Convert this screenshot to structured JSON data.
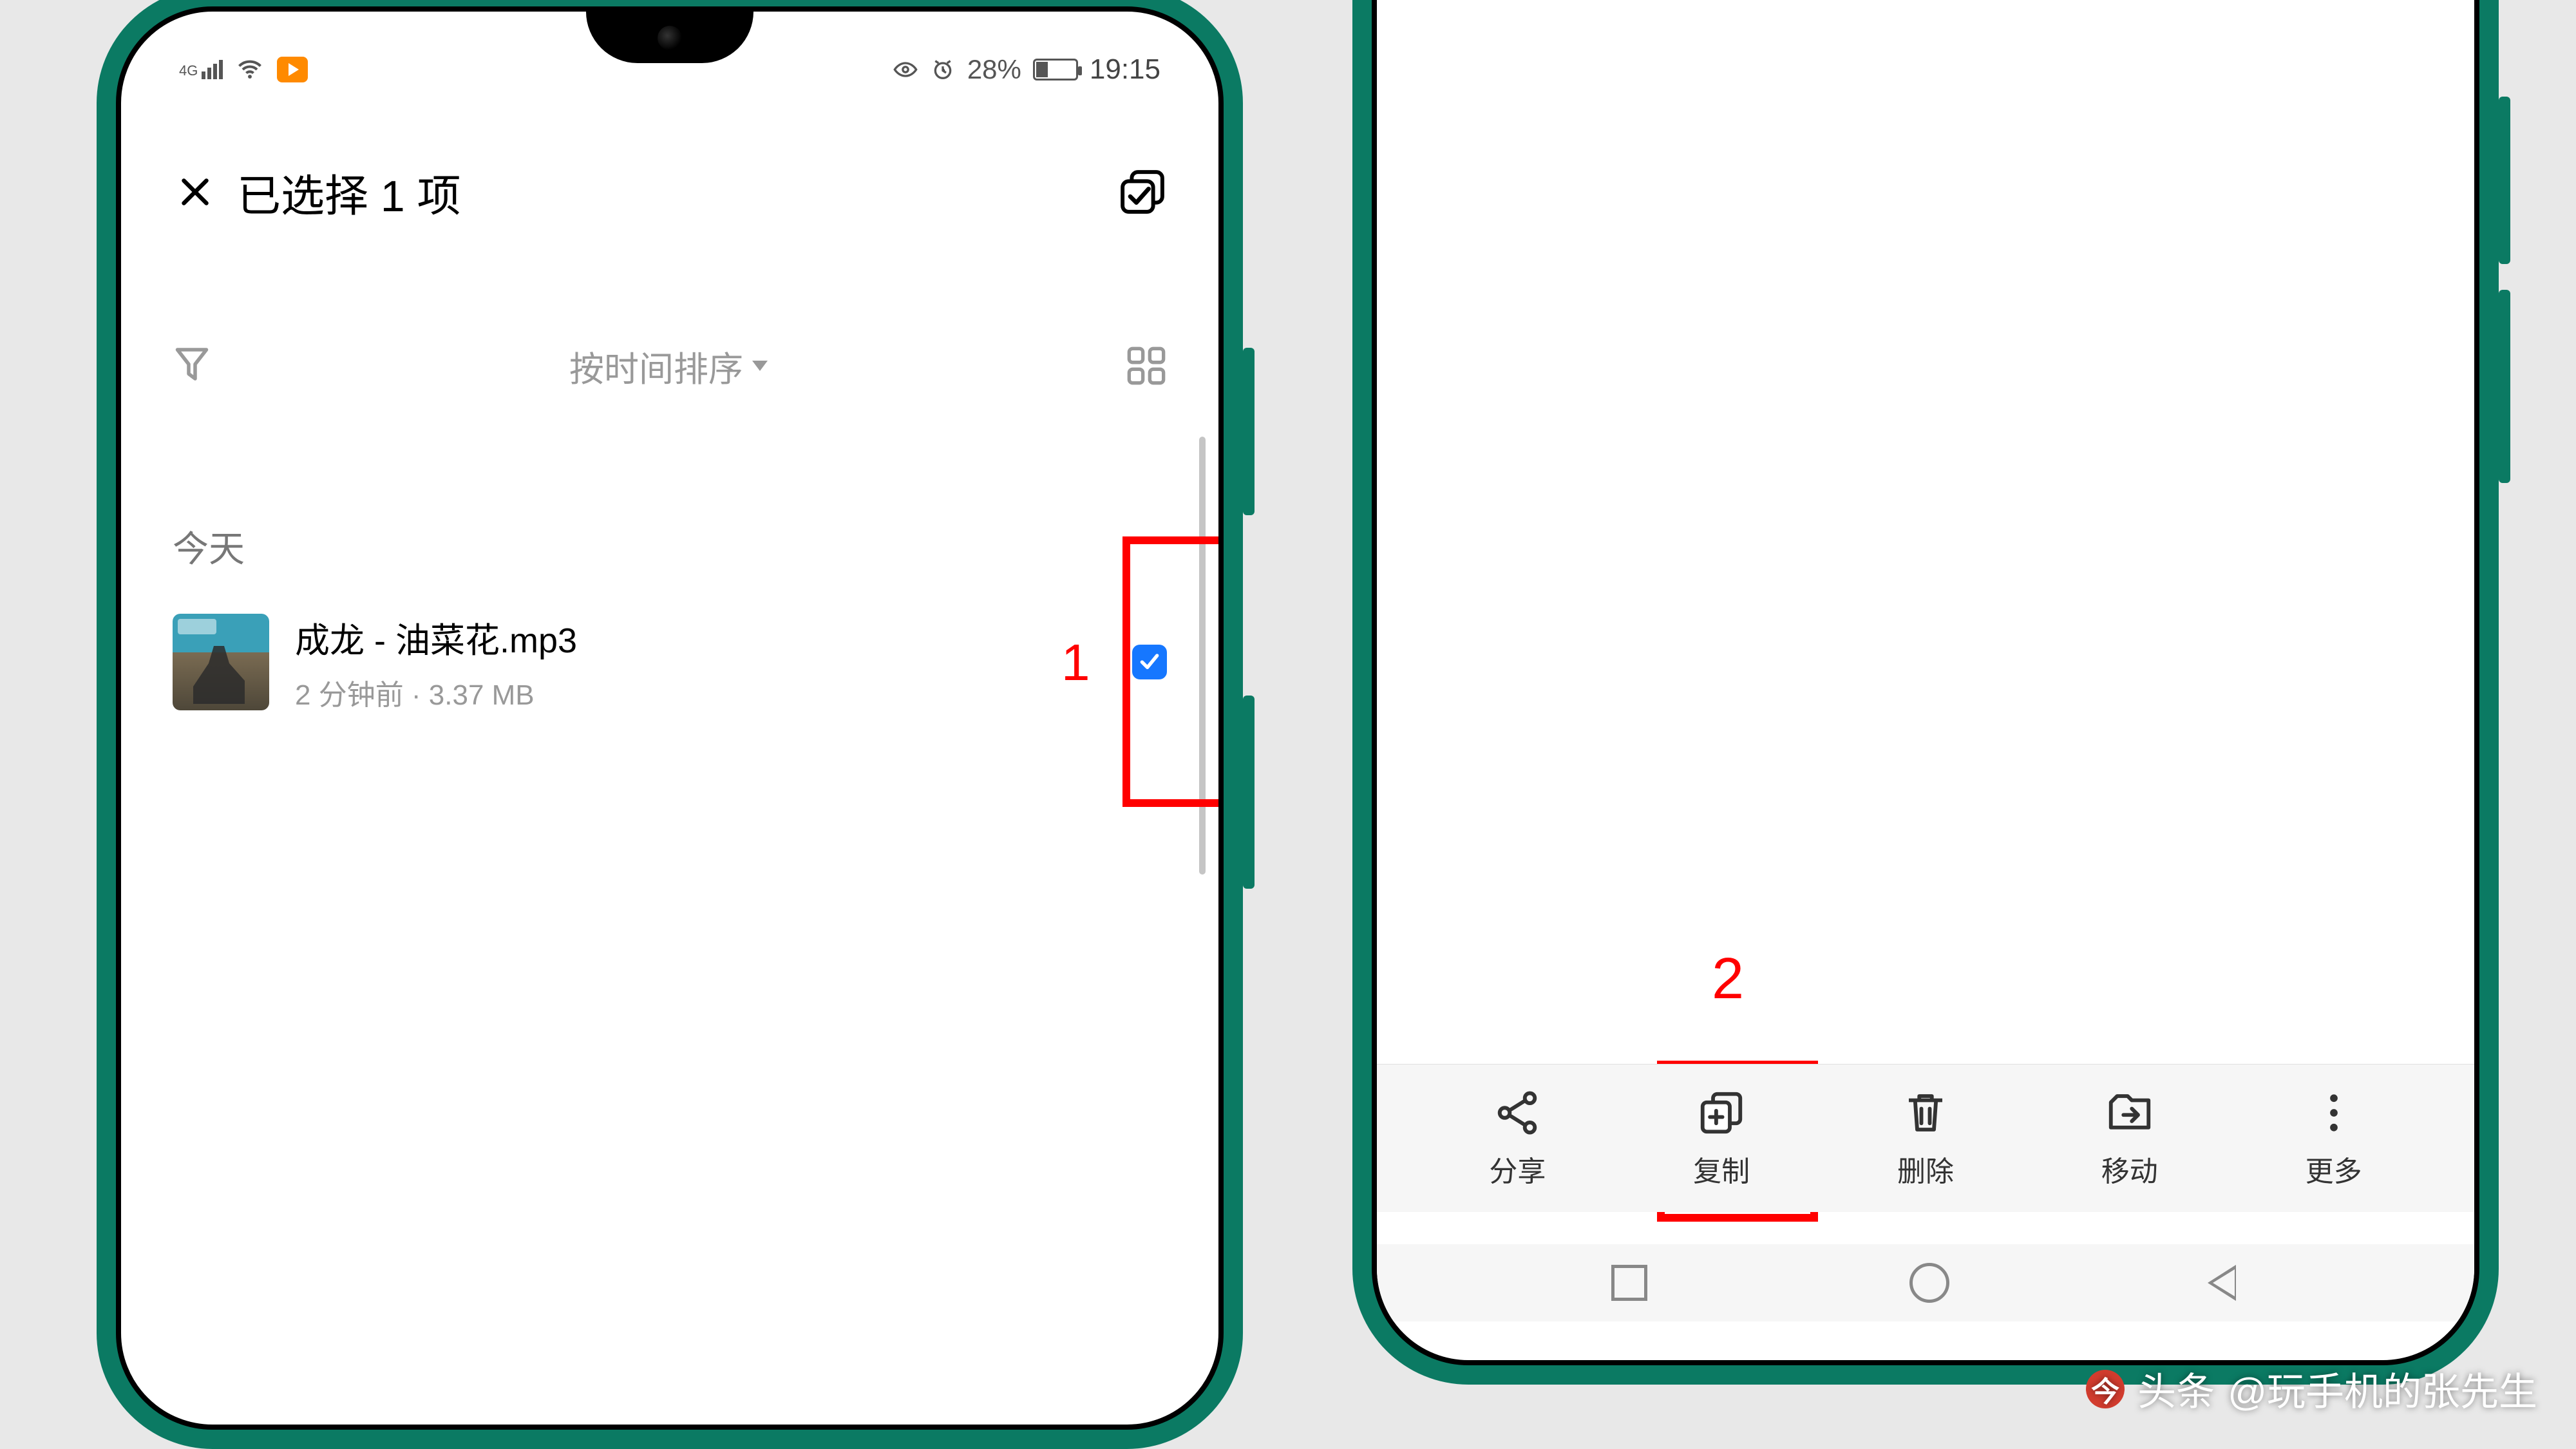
{
  "statusbar": {
    "network": "4G",
    "battery_pct": "28%",
    "time": "19:15"
  },
  "header": {
    "title": "已选择 1 项"
  },
  "sort": {
    "label": "按时间排序"
  },
  "section": {
    "today": "今天"
  },
  "file": {
    "name": "成龙 - 油菜花.mp3",
    "meta": "2 分钟前 · 3.37 MB"
  },
  "annotations": {
    "one": "1",
    "two": "2"
  },
  "actions": {
    "share": "分享",
    "copy": "复制",
    "delete": "删除",
    "move": "移动",
    "more": "更多"
  },
  "watermark": {
    "brand": "头条",
    "author": "@玩手机的张先生"
  }
}
